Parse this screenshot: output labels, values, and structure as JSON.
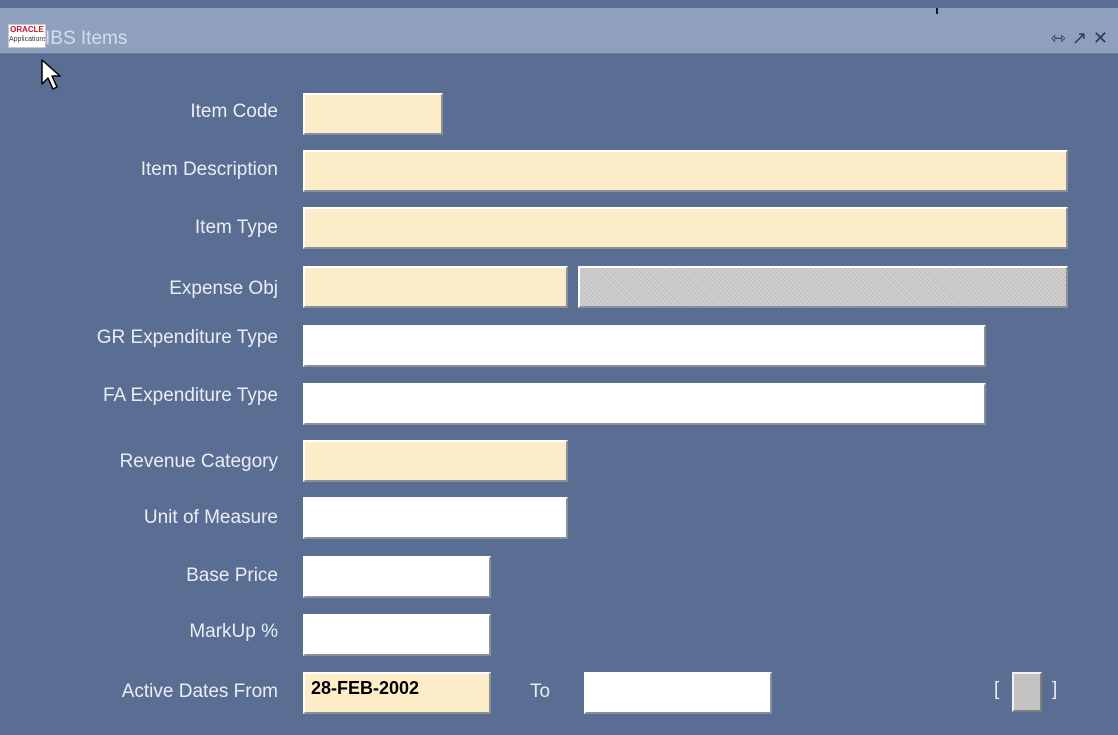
{
  "window": {
    "title": "IBS Items",
    "app_logo_text": "ORACLE",
    "app_logo_sub": "Applications",
    "controls": [
      "minimize-icon",
      "maximize-icon",
      "close-icon"
    ]
  },
  "form": {
    "item_code": {
      "label": "Item Code",
      "value": ""
    },
    "item_description": {
      "label": "Item Description",
      "value": ""
    },
    "item_type": {
      "label": "Item Type",
      "value": ""
    },
    "expense_obj": {
      "label": "Expense Obj",
      "value": "",
      "desc_value": ""
    },
    "gr_expenditure_type": {
      "label": "GR Expenditure Type",
      "value": ""
    },
    "fa_expenditure_type": {
      "label": "FA Expenditure Type",
      "value": ""
    },
    "revenue_category": {
      "label": "Revenue Category",
      "value": ""
    },
    "unit_of_measure": {
      "label": "Unit of Measure",
      "value": ""
    },
    "base_price": {
      "label": "Base Price",
      "value": ""
    },
    "markup_pct": {
      "label": "MarkUp %",
      "value": ""
    },
    "active_dates": {
      "from_label": "Active Dates From",
      "from_value": "28-FEB-2002",
      "to_label": "To",
      "to_value": ""
    },
    "flex": {
      "open_bracket": "[",
      "close_bracket": "]"
    }
  },
  "colors": {
    "background": "#5a6d92",
    "titlebar": "#8ea0bd",
    "required_field": "#fdecc8",
    "optional_field": "#ffffff",
    "readonly_field": "#c7c7c7"
  }
}
